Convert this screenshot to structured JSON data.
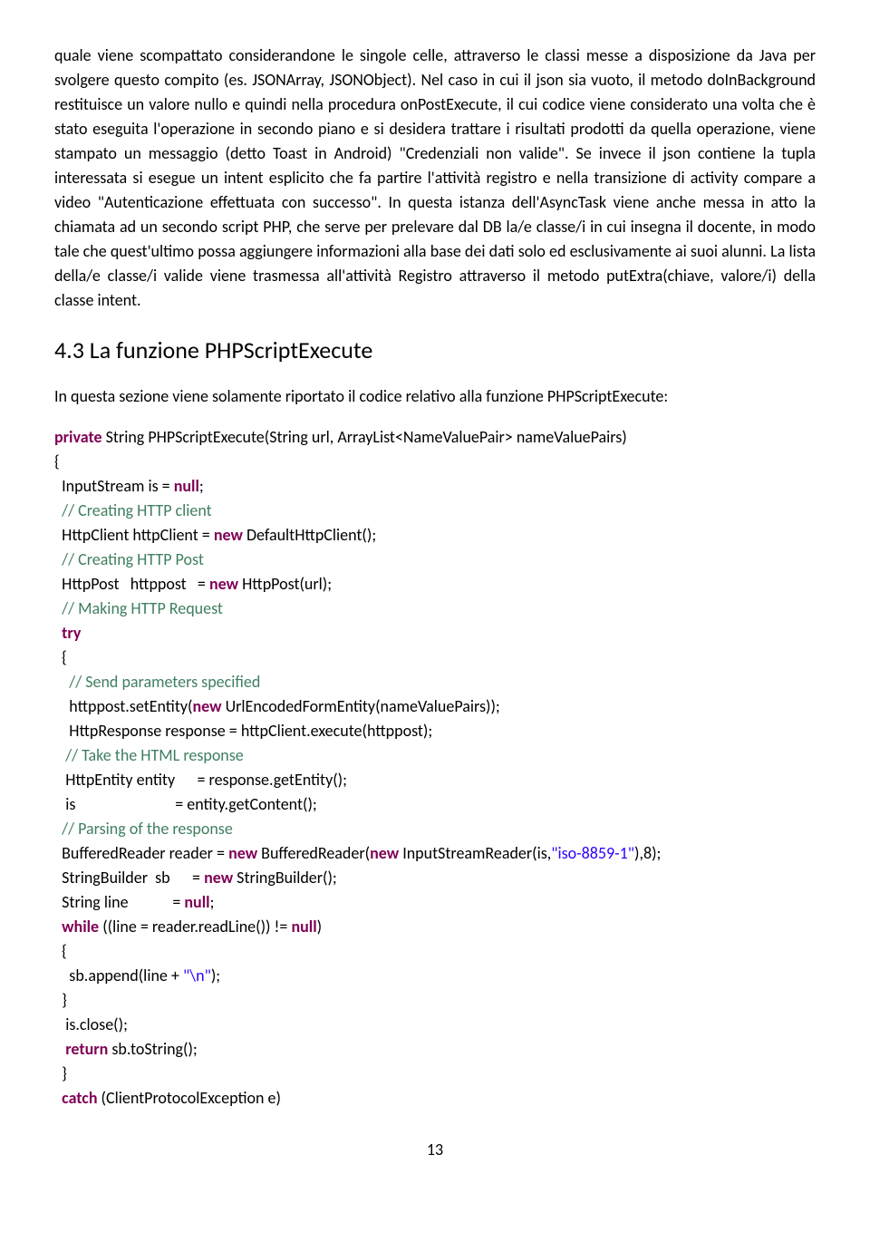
{
  "para1": "quale viene scompattato considerandone le singole celle, attraverso le classi messe a disposizione da Java per svolgere questo compito (es. JSONArray, JSONObject). Nel caso in cui il json sia vuoto, il metodo doInBackground restituisce un valore nullo e quindi nella procedura onPostExecute, il cui codice viene considerato una volta che è stato eseguita l'operazione in secondo piano e si desidera trattare i risultati prodotti da quella operazione, viene stampato un messaggio (detto Toast in Android) \"Credenziali non valide\". Se invece il json contiene la tupla interessata si esegue un intent esplicito che fa partire l'attività registro e nella transizione di activity compare a video \"Autenticazione effettuata con successo\". In questa istanza dell'AsyncTask viene anche messa in atto la chiamata ad un secondo script PHP, che serve per prelevare dal DB la/e classe/i in cui insegna il docente, in modo tale che quest'ultimo possa aggiungere informazioni alla base dei dati solo ed esclusivamente ai suoi alunni. La lista della/e classe/i valide viene trasmessa all'attività Registro attraverso il metodo putExtra(chiave, valore/i) della classe intent.",
  "heading": "4.3 La funzione PHPScriptExecute",
  "intro": "In questa sezione viene solamente riportato il codice relativo alla funzione PHPScriptExecute:",
  "code": {
    "l1_kw": "private",
    "l1_rest": " String PHPScriptExecute(String url, ArrayList<NameValuePair> nameValuePairs)",
    "l2": "{",
    "l3a": "  InputStream is = ",
    "l3_kw": "null",
    "l3b": ";",
    "l4": "  // Creating HTTP client",
    "l5a": "  HttpClient httpClient = ",
    "l5_kw": "new",
    "l5b": " DefaultHttpClient();",
    "l6": "  // Creating HTTP Post",
    "l7a": "  HttpPost   httppost   = ",
    "l7_kw": "new",
    "l7b": " HttpPost(url);",
    "l8": "  // Making HTTP Request",
    "l9": "  try",
    "l10": "  {",
    "l11": "    // Send parameters specified",
    "l12a": "    httppost.setEntity(",
    "l12_kw": "new",
    "l12b": " UrlEncodedFormEntity(nameValuePairs));",
    "l13": "    HttpResponse response = httpClient.execute(httppost);",
    "l14": "   // Take the HTML response",
    "l15": "   HttpEntity entity      = response.getEntity();",
    "l16": "   is                           = entity.getContent();",
    "l17": "  // Parsing of the response",
    "l18a": "  BufferedReader reader = ",
    "l18_kw1": "new",
    "l18b": " BufferedReader(",
    "l18_kw2": "new",
    "l18c": " InputStreamReader(is,",
    "l18_str": "\"iso-8859-1\"",
    "l18d": "),8);",
    "l19a": "  StringBuilder  sb      = ",
    "l19_kw": "new",
    "l19b": " StringBuilder();",
    "l20a": "  String line            = ",
    "l20_kw": "null",
    "l20b": ";",
    "l21_kw1": "  while",
    "l21a": " ((line = reader.readLine()) != ",
    "l21_kw2": "null",
    "l21b": ")",
    "l22": "  {",
    "l23a": "    sb.append(line + ",
    "l23_str": "\"\\n\"",
    "l23b": ");",
    "l24": "  }",
    "l25": "   is.close();",
    "l26_kw": "   return",
    "l26a": " sb.toString();",
    "l27": "  }",
    "l28_kw": "  catch",
    "l28a": " (ClientProtocolException e)"
  },
  "pageNum": "13"
}
